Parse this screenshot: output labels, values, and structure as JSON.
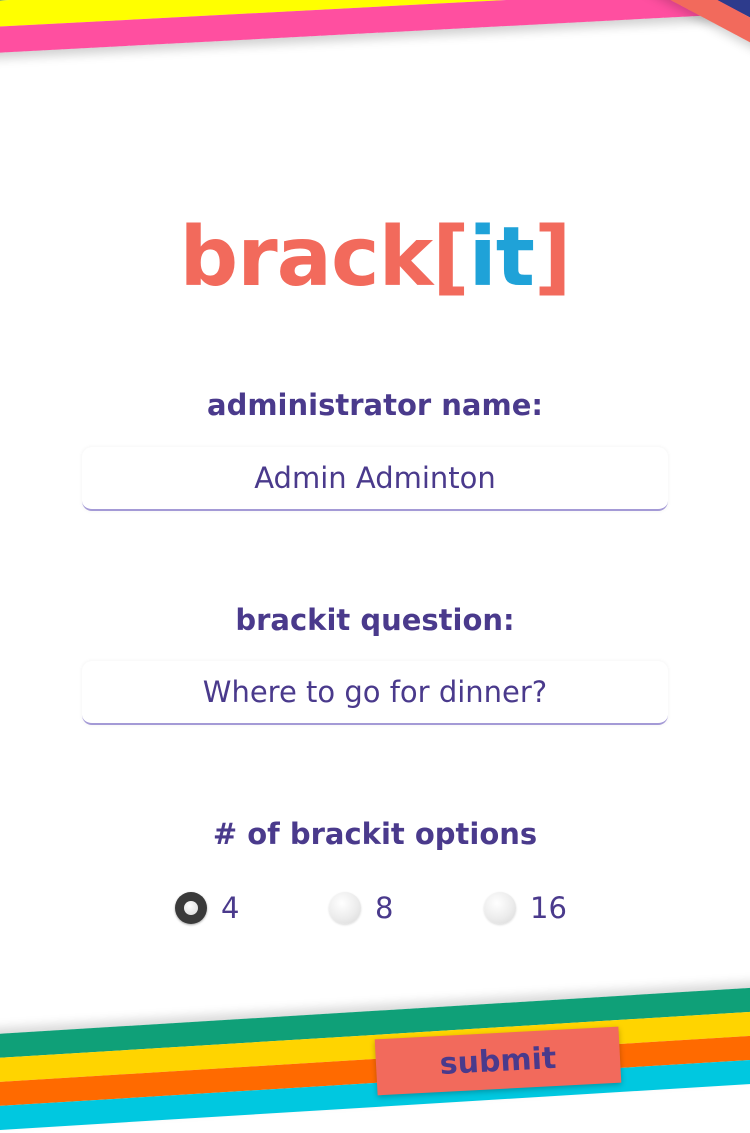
{
  "logo": {
    "word": "brack",
    "open_bracket": "[",
    "it": "it",
    "close_bracket": "]"
  },
  "form": {
    "admin_label": "administrator name:",
    "admin_value": "Admin Adminton",
    "question_label": "brackit question:",
    "question_value": "Where to go for dinner?",
    "options_label": "# of brackit options",
    "options": [
      {
        "label": "4",
        "selected": true
      },
      {
        "label": "8",
        "selected": false
      },
      {
        "label": "16",
        "selected": false
      }
    ],
    "submit_label": "submit"
  },
  "colors": {
    "accent": "#f26a5c",
    "logo_it": "#1fa2d8",
    "text": "#4a3a8c",
    "stripes_top": [
      "#1e7fa0",
      "#f26a5c",
      "#2d3b8c",
      "#8ef04a",
      "#1f6f93",
      "#ffff00",
      "#ff4fa0"
    ],
    "stripes_corner": [
      "#ff4fa0",
      "#8ef04a",
      "#2d3b8c",
      "#f26a5c"
    ],
    "stripes_bottom": [
      "#0fa078",
      "#ffd400",
      "#ff6a00",
      "#00c8e0"
    ]
  }
}
